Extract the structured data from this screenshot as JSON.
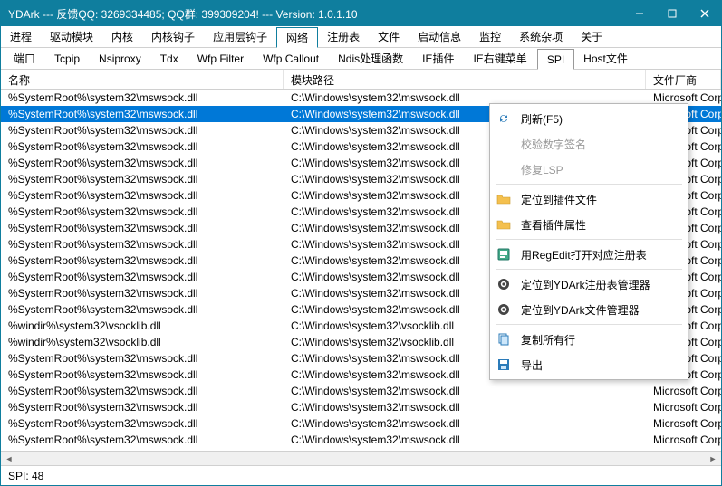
{
  "title": "YDArk --- 反馈QQ: 3269334485; QQ群: 399309204! --- Version: 1.0.1.10",
  "menu": [
    "进程",
    "驱动模块",
    "内核",
    "内核钩子",
    "应用层钩子",
    "网络",
    "注册表",
    "文件",
    "启动信息",
    "监控",
    "系统杂项",
    "关于"
  ],
  "menu_active": 5,
  "tabs": [
    "端口",
    "Tcpip",
    "Nsiproxy",
    "Tdx",
    "Wfp Filter",
    "Wfp Callout",
    "Ndis处理函数",
    "IE插件",
    "IE右键菜单",
    "SPI",
    "Host文件"
  ],
  "tabs_active": 9,
  "cols": {
    "c1": "名称",
    "c2": "模块路径",
    "c3": "文件厂商"
  },
  "vendor": "Microsoft Corporation",
  "rows": [
    {
      "n": "%SystemRoot%\\system32\\mswsock.dll",
      "p": "C:\\Windows\\system32\\mswsock.dll"
    },
    {
      "n": "%SystemRoot%\\system32\\mswsock.dll",
      "p": "C:\\Windows\\system32\\mswsock.dll",
      "sel": true
    },
    {
      "n": "%SystemRoot%\\system32\\mswsock.dll",
      "p": "C:\\Windows\\system32\\mswsock.dll"
    },
    {
      "n": "%SystemRoot%\\system32\\mswsock.dll",
      "p": "C:\\Windows\\system32\\mswsock.dll"
    },
    {
      "n": "%SystemRoot%\\system32\\mswsock.dll",
      "p": "C:\\Windows\\system32\\mswsock.dll"
    },
    {
      "n": "%SystemRoot%\\system32\\mswsock.dll",
      "p": "C:\\Windows\\system32\\mswsock.dll"
    },
    {
      "n": "%SystemRoot%\\system32\\mswsock.dll",
      "p": "C:\\Windows\\system32\\mswsock.dll"
    },
    {
      "n": "%SystemRoot%\\system32\\mswsock.dll",
      "p": "C:\\Windows\\system32\\mswsock.dll"
    },
    {
      "n": "%SystemRoot%\\system32\\mswsock.dll",
      "p": "C:\\Windows\\system32\\mswsock.dll"
    },
    {
      "n": "%SystemRoot%\\system32\\mswsock.dll",
      "p": "C:\\Windows\\system32\\mswsock.dll"
    },
    {
      "n": "%SystemRoot%\\system32\\mswsock.dll",
      "p": "C:\\Windows\\system32\\mswsock.dll"
    },
    {
      "n": "%SystemRoot%\\system32\\mswsock.dll",
      "p": "C:\\Windows\\system32\\mswsock.dll"
    },
    {
      "n": "%SystemRoot%\\system32\\mswsock.dll",
      "p": "C:\\Windows\\system32\\mswsock.dll"
    },
    {
      "n": "%SystemRoot%\\system32\\mswsock.dll",
      "p": "C:\\Windows\\system32\\mswsock.dll"
    },
    {
      "n": "%windir%\\system32\\vsocklib.dll",
      "p": "C:\\Windows\\system32\\vsocklib.dll"
    },
    {
      "n": "%windir%\\system32\\vsocklib.dll",
      "p": "C:\\Windows\\system32\\vsocklib.dll"
    },
    {
      "n": "%SystemRoot%\\system32\\mswsock.dll",
      "p": "C:\\Windows\\system32\\mswsock.dll"
    },
    {
      "n": "%SystemRoot%\\system32\\mswsock.dll",
      "p": "C:\\Windows\\system32\\mswsock.dll"
    },
    {
      "n": "%SystemRoot%\\system32\\mswsock.dll",
      "p": "C:\\Windows\\system32\\mswsock.dll"
    },
    {
      "n": "%SystemRoot%\\system32\\mswsock.dll",
      "p": "C:\\Windows\\system32\\mswsock.dll"
    },
    {
      "n": "%SystemRoot%\\system32\\mswsock.dll",
      "p": "C:\\Windows\\system32\\mswsock.dll"
    },
    {
      "n": "%SystemRoot%\\system32\\mswsock.dll",
      "p": "C:\\Windows\\system32\\mswsock.dll"
    }
  ],
  "ctx": [
    {
      "t": "刷新(F5)",
      "i": "refresh"
    },
    {
      "t": "校验数字签名",
      "disabled": true
    },
    {
      "t": "修复LSP",
      "disabled": true
    },
    {
      "sep": true
    },
    {
      "t": "定位到插件文件",
      "i": "folder"
    },
    {
      "t": "查看插件属性",
      "i": "folder"
    },
    {
      "sep": true
    },
    {
      "t": "用RegEdit打开对应注册表",
      "i": "reg"
    },
    {
      "sep": true
    },
    {
      "t": "定位到YDArk注册表管理器",
      "i": "gear"
    },
    {
      "t": "定位到YDArk文件管理器",
      "i": "gear"
    },
    {
      "sep": true
    },
    {
      "t": "复制所有行",
      "i": "copy"
    },
    {
      "t": "导出",
      "i": "save"
    }
  ],
  "status": "SPI: 48"
}
